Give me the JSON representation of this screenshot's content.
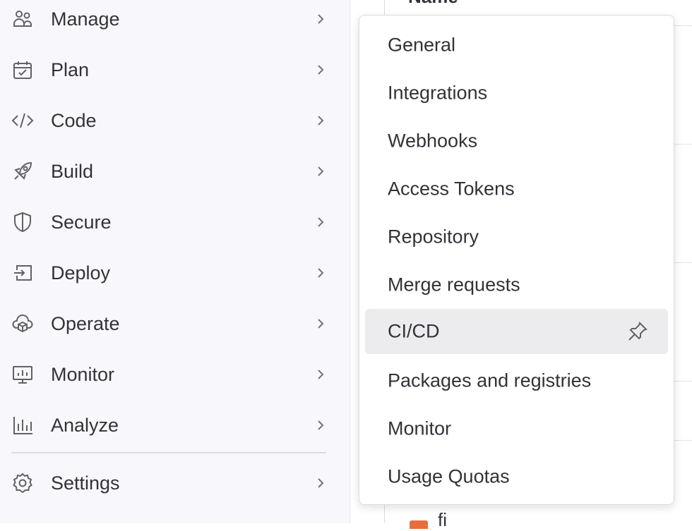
{
  "sidebar": {
    "items": [
      {
        "label": "Manage",
        "icon": "users-icon"
      },
      {
        "label": "Plan",
        "icon": "calendar-icon"
      },
      {
        "label": "Code",
        "icon": "code-icon"
      },
      {
        "label": "Build",
        "icon": "rocket-icon"
      },
      {
        "label": "Secure",
        "icon": "shield-icon"
      },
      {
        "label": "Deploy",
        "icon": "deploy-icon"
      },
      {
        "label": "Operate",
        "icon": "cloud-cube-icon"
      },
      {
        "label": "Monitor",
        "icon": "monitor-icon"
      },
      {
        "label": "Analyze",
        "icon": "chart-icon"
      },
      {
        "label": "Settings",
        "icon": "gear-icon"
      }
    ]
  },
  "main": {
    "column_header": "Name",
    "file_fragment": "fi"
  },
  "settings_menu": {
    "items": [
      {
        "label": "General"
      },
      {
        "label": "Integrations"
      },
      {
        "label": "Webhooks"
      },
      {
        "label": "Access Tokens"
      },
      {
        "label": "Repository"
      },
      {
        "label": "Merge requests"
      },
      {
        "label": "CI/CD",
        "highlighted": true,
        "pin_icon": "pin-icon"
      },
      {
        "label": "Packages and registries"
      },
      {
        "label": "Monitor"
      },
      {
        "label": "Usage Quotas"
      }
    ]
  },
  "colors": {
    "sidebar_bg": "#f8f8fc",
    "text": "#333238",
    "icon": "#626168",
    "highlight_bg": "#ececef"
  }
}
